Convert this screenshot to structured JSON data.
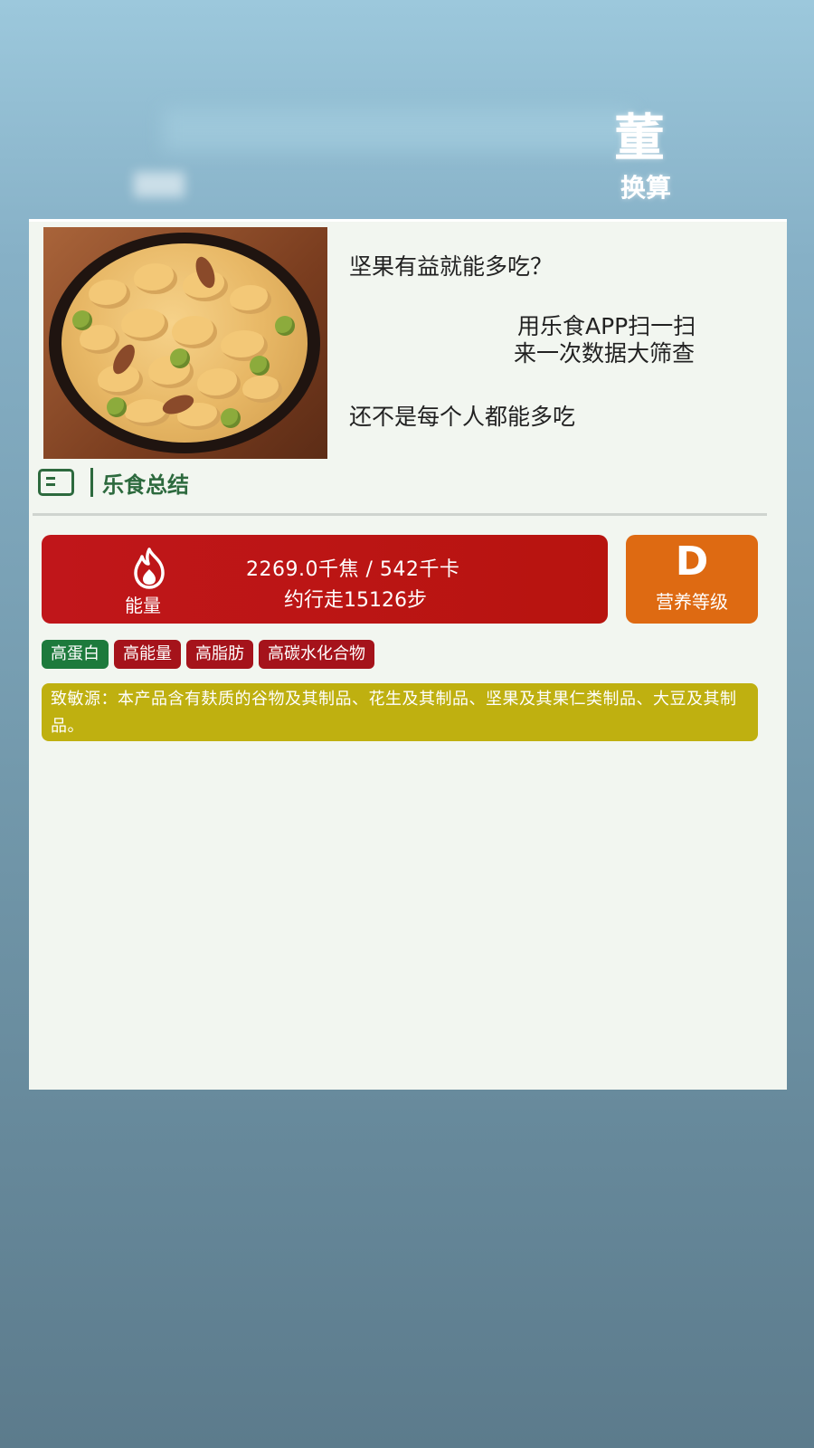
{
  "header": {
    "title_fragment": "董",
    "subtitle_fragment": "换算"
  },
  "promo": {
    "question": "坚果有益就能多吃？",
    "app_line1": "用乐食APP扫一扫",
    "app_line2": "来一次数据大筛查",
    "not_everyone": "还不是每个人都能多吃"
  },
  "summary": {
    "title": "乐食总结"
  },
  "energy": {
    "label": "能量",
    "value": "2269.0千焦 / 542千卡",
    "steps": "约行走15126步"
  },
  "grade": {
    "letter": "D",
    "label": "营养等级"
  },
  "tags": [
    {
      "label": "高蛋白"
    },
    {
      "label": "高能量"
    },
    {
      "label": "高脂肪"
    },
    {
      "label": "高碳水化合物"
    }
  ],
  "allergen": {
    "text": "致敏源：本产品含有麸质的谷物及其制品、花生及其制品、坚果及其果仁类制品、大豆及其制品。"
  },
  "colors": {
    "brand_green": "#2d6a3e",
    "energy_red": "#b7140f",
    "grade_orange": "#de6a12",
    "allergen_yellow": "#bfb010"
  },
  "icons": {
    "summary": "document-icon",
    "energy": "flame-icon"
  }
}
